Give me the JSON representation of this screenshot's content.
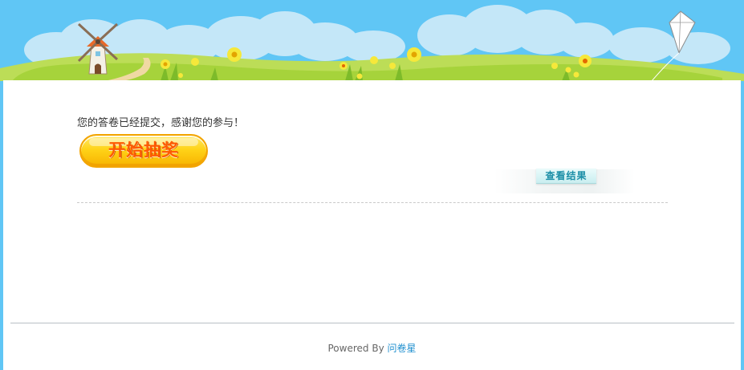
{
  "banner": {
    "sky_color": "#60c6f5",
    "grass_color": "#a6d33b",
    "cloud_color": "#c4e7f8",
    "icons": [
      "windmill-icon",
      "kite-icon",
      "flower-icon"
    ]
  },
  "survey": {
    "submitted_message": "您的答卷已经提交，感谢您的参与！",
    "lottery_button_label": "开始抽奖",
    "view_results_label": "查看结果"
  },
  "footer": {
    "powered_by": "Powered By ",
    "brand": "问卷星"
  },
  "colors": {
    "page_background": "#ffffff",
    "lottery_button": "#ffd318",
    "lottery_text": "#ff5a00",
    "results_text": "#1c8fa7",
    "link": "#1f8fcf"
  }
}
